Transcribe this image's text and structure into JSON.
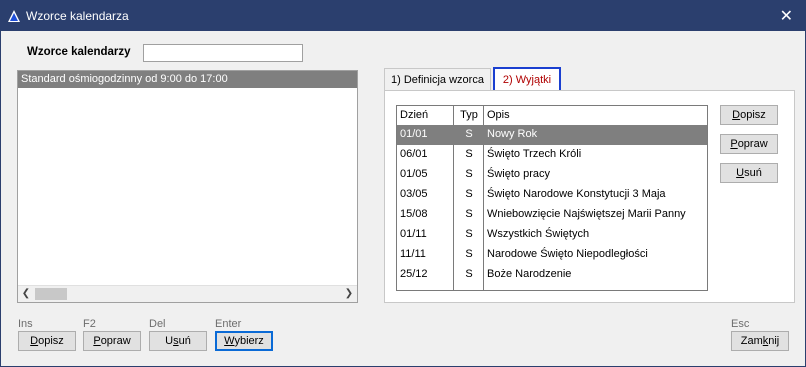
{
  "window": {
    "title": "Wzorce kalendarza",
    "close_glyph": "✕",
    "accent": "#2b3f6e"
  },
  "search": {
    "label": "Wzorce kalendarzy",
    "value": "",
    "placeholder": ""
  },
  "patterns": {
    "items": [
      "Standard ośmiogodzinny od 9:00 do 17:00"
    ],
    "scroll_left": "❮",
    "scroll_right": "❯"
  },
  "tabs": [
    {
      "label": "1) Definicja wzorca"
    },
    {
      "label": "2) Wyjątki"
    }
  ],
  "exceptions": {
    "headers": {
      "day": "Dzień",
      "type": "Typ",
      "desc": "Opis"
    },
    "rows": [
      {
        "day": "01/01",
        "type": "S",
        "desc": "Nowy Rok"
      },
      {
        "day": "06/01",
        "type": "S",
        "desc": "Święto Trzech Króli"
      },
      {
        "day": "01/05",
        "type": "S",
        "desc": "Święto pracy"
      },
      {
        "day": "03/05",
        "type": "S",
        "desc": "Święto Narodowe Konstytucji 3 Maja"
      },
      {
        "day": "15/08",
        "type": "S",
        "desc": "Wniebowzięcie Najświętszej Marii Panny"
      },
      {
        "day": "01/11",
        "type": "S",
        "desc": "Wszystkich Świętych"
      },
      {
        "day": "11/11",
        "type": "S",
        "desc": "Narodowe Święto Niepodległości"
      },
      {
        "day": "25/12",
        "type": "S",
        "desc": "Boże Narodzenie"
      }
    ]
  },
  "side_buttons": {
    "add": {
      "u": "D",
      "rest": "opisz"
    },
    "edit": {
      "u": "P",
      "rest": "opraw"
    },
    "delete": {
      "u": "U",
      "rest": "suń"
    }
  },
  "bottom": {
    "add": {
      "hint": "Ins",
      "u": "D",
      "rest": "opisz"
    },
    "edit": {
      "hint": "F2",
      "u": "P",
      "rest": "opraw"
    },
    "delete": {
      "hint": "Del",
      "pre": "U",
      "u": "s",
      "rest": "uń"
    },
    "select": {
      "hint": "Enter",
      "u": "W",
      "rest": "ybierz"
    },
    "close": {
      "hint": "Esc",
      "pre": "Zam",
      "u": "k",
      "rest": "nij"
    }
  }
}
